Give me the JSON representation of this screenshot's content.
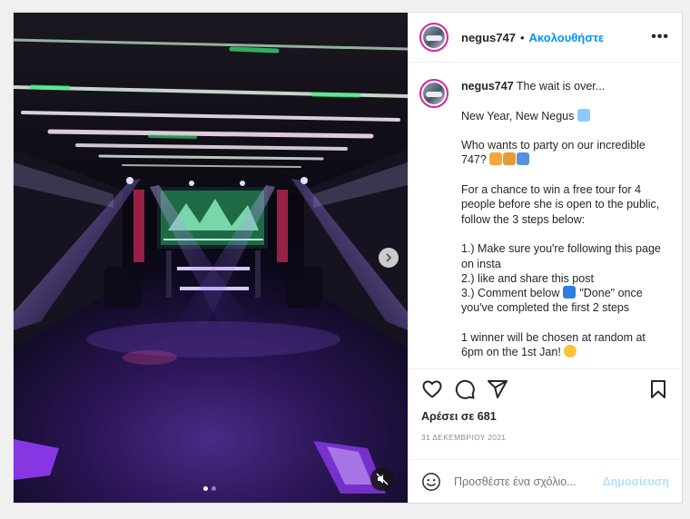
{
  "post": {
    "username": "negus747",
    "separator": "•",
    "follow_label": "Ακολουθήστε",
    "more_label": "•••",
    "caption": {
      "username": "negus747",
      "line1": "The wait is over...",
      "line2": "New Year, New Negus",
      "line3": "Who wants to party on our incredible 747?",
      "line4": "For a chance to win a free tour for 4 people before she is open to the public, follow the 3 steps below:",
      "step1": "1.) Make sure you're following this page on insta",
      "step2": "2.) like and share this post",
      "step3a": "3.) Comment below",
      "step3b": "\"Done\" once you've completed the first 2 steps",
      "line5": "1 winner will be chosen at random at 6pm on the 1st Jan!"
    },
    "likes": "Αρέσει σε 681",
    "date": "31 ΔΕΚΕΜΒΡΙΟΥ 2021",
    "comment_placeholder": "Προσθέστε ένα σχόλιο...",
    "publish_label": "Δημοσίευση"
  },
  "media": {
    "carousel": {
      "count": 2,
      "active": 1
    },
    "icons": [
      "chevron-right-icon",
      "volume-muted-icon"
    ]
  },
  "colors": {
    "accent": "#0095f6",
    "publish_disabled": "#b2dffc",
    "text": "#262626",
    "muted": "#8e8e8e"
  },
  "icons": [
    "heart-icon",
    "comment-icon",
    "share-icon",
    "bookmark-icon",
    "smiley-icon"
  ]
}
